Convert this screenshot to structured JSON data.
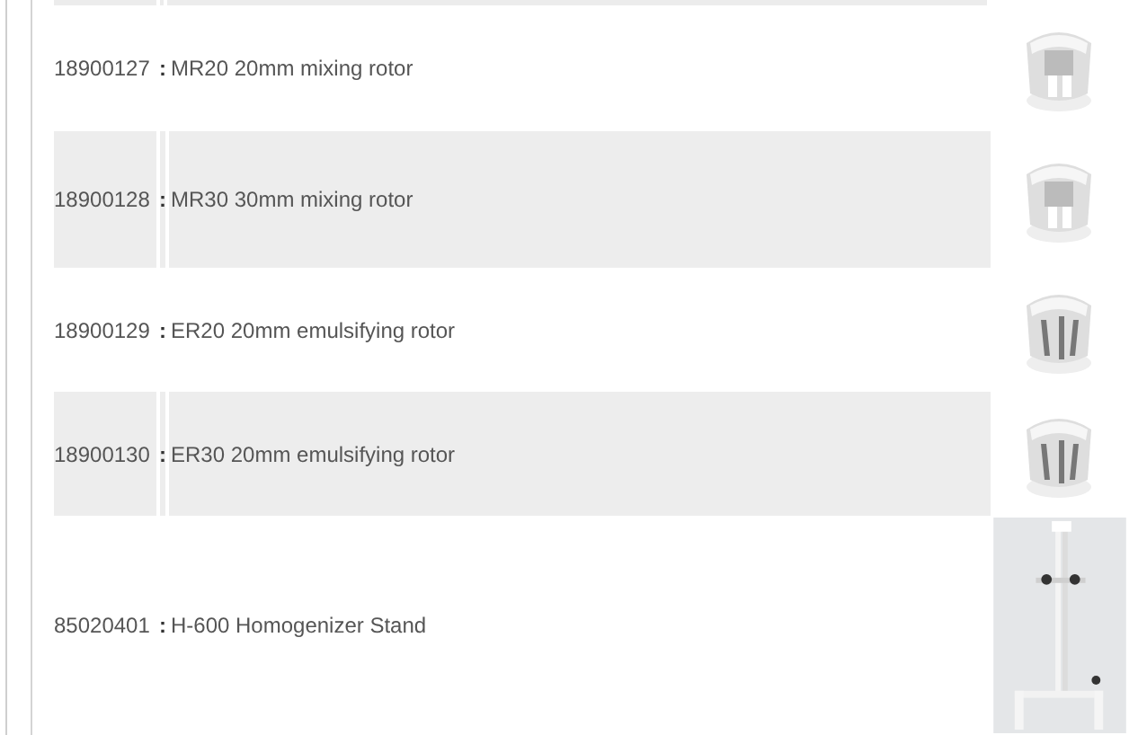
{
  "rows": [
    {
      "code": "18900127",
      "separator": ":",
      "name": "MR20 20mm mixing rotor"
    },
    {
      "code": "18900128",
      "separator": ":",
      "name": "MR30 30mm mixing rotor"
    },
    {
      "code": "18900129",
      "separator": ":",
      "name": "ER20 20mm emulsifying rotor"
    },
    {
      "code": "18900130",
      "separator": ":",
      "name": "ER30 20mm emulsifying rotor"
    },
    {
      "code": "85020401",
      "separator": ":",
      "name": "H-600 Homogenizer Stand"
    }
  ]
}
